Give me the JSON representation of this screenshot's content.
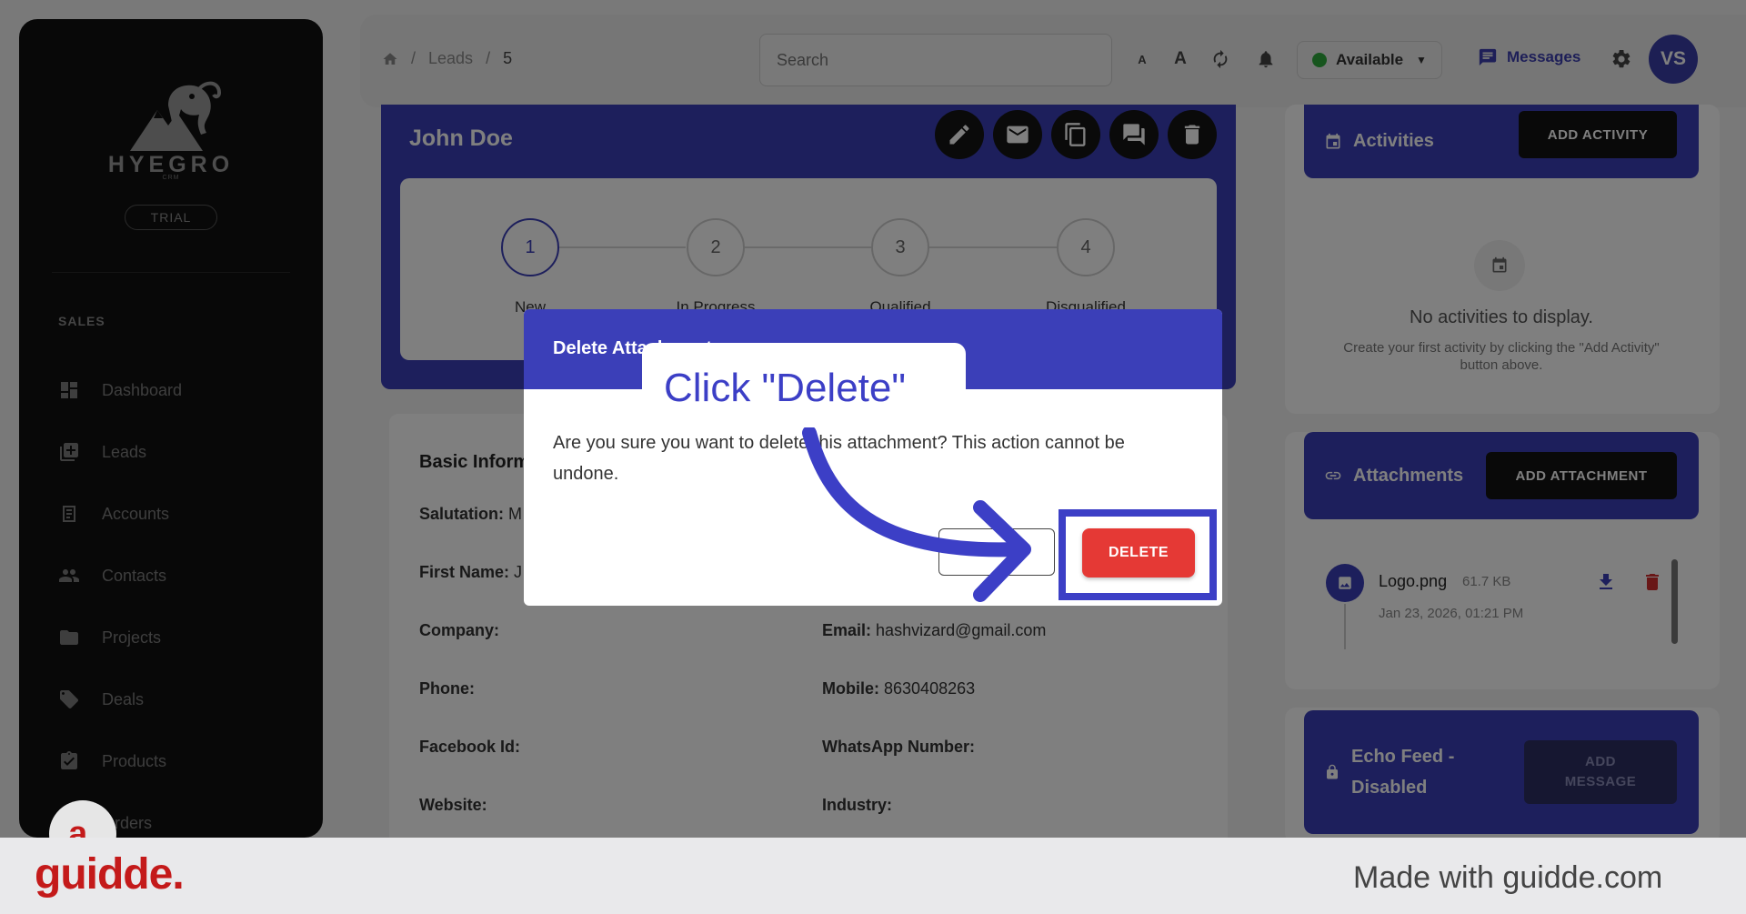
{
  "sidebar": {
    "brand": "HYEGRO",
    "brand_sub": "CRM",
    "plan_badge": "TRIAL",
    "section": "SALES",
    "items": [
      {
        "label": "Dashboard",
        "icon": "dashboard-icon"
      },
      {
        "label": "Leads",
        "icon": "leads-icon"
      },
      {
        "label": "Accounts",
        "icon": "accounts-icon"
      },
      {
        "label": "Contacts",
        "icon": "contacts-icon"
      },
      {
        "label": "Projects",
        "icon": "folder-icon"
      },
      {
        "label": "Deals",
        "icon": "tag-icon"
      },
      {
        "label": "Products",
        "icon": "clipboard-icon"
      },
      {
        "label": "Orders",
        "icon": "cart-icon"
      }
    ]
  },
  "header": {
    "breadcrumb": [
      "Leads",
      "5"
    ],
    "search_placeholder": "Search",
    "font_small": "A",
    "font_large": "A",
    "status": "Available",
    "messages": "Messages",
    "avatar_initials": "VS"
  },
  "lead": {
    "name": "John Doe",
    "steps": [
      {
        "num": "1",
        "label": "New"
      },
      {
        "num": "2",
        "label": "In Progress"
      },
      {
        "num": "3",
        "label": "Qualified"
      },
      {
        "num": "4",
        "label": "Disqualified"
      }
    ]
  },
  "basic_info": {
    "title": "Basic Information",
    "salutation_label": "Salutation:",
    "salutation_value": "M",
    "first_name_label": "First Name:",
    "first_name_value": "J",
    "company_label": "Company:",
    "email_label": "Email:",
    "email_value": "hashvizard@gmail.com",
    "phone_label": "Phone:",
    "mobile_label": "Mobile:",
    "mobile_value": "8630408263",
    "facebook_label": "Facebook Id:",
    "whatsapp_label": "WhatsApp Number:",
    "website_label": "Website:",
    "industry_label": "Industry:"
  },
  "activities": {
    "title": "Activities",
    "button": "ADD ACTIVITY",
    "empty_title": "No activities to display.",
    "empty_sub": "Create your first activity by clicking the \"Add Activity\" button above."
  },
  "attachments": {
    "title": "Attachments",
    "button": "ADD ATTACHMENT",
    "file_name": "Logo.png",
    "file_size": "61.7 KB",
    "file_date": "Jan 23, 2026, 01:21 PM"
  },
  "echo_feed": {
    "title": "Echo Feed - Disabled",
    "button": "ADD MESSAGE"
  },
  "modal": {
    "title": "Delete Attachment",
    "body": "Are you sure you want to delete this attachment? This action cannot be undone.",
    "cancel": "CANCEL",
    "delete": "DELETE"
  },
  "annotation": {
    "callout": "Click \"Delete\""
  },
  "footer": {
    "logo": "guidde.",
    "badge": "a.",
    "tagline": "Made with guidde.com"
  },
  "colors": {
    "primary": "#3b3fb8",
    "danger": "#e53935",
    "annotation": "#3c3fc6",
    "guidde_red": "#c41a1a"
  }
}
